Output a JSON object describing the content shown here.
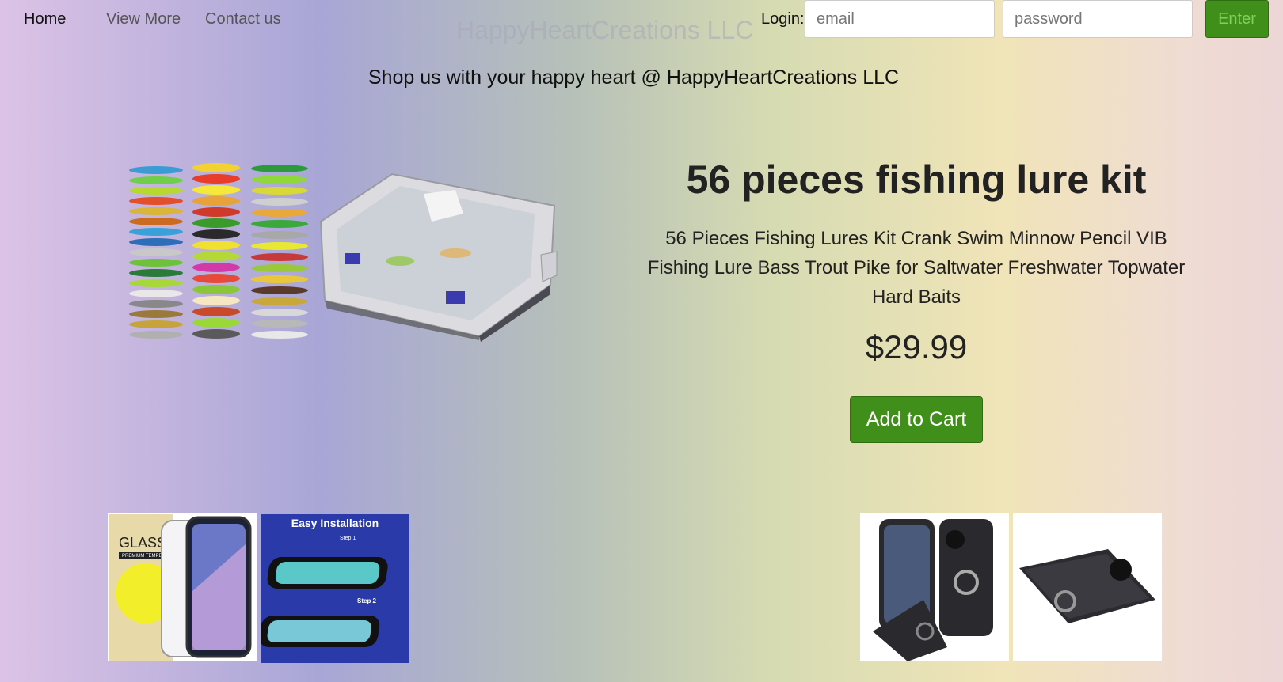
{
  "nav": {
    "home": "Home",
    "view_more": "View More",
    "contact": "Contact us"
  },
  "brand": "HappyHeartCreations LLC",
  "login": {
    "label": "Login:",
    "email_placeholder": "email",
    "password_placeholder": "password",
    "enter_label": "Enter"
  },
  "tagline": "Shop us with your happy heart @ HappyHeartCreations LLC",
  "product": {
    "title": "56 pieces fishing lure kit",
    "description": "56 Pieces Fishing Lures Kit Crank Swim Minnow Pencil VIB Fishing Lure Bass Trout Pike for Saltwater Freshwater Topwater Hard Baits",
    "price": "$29.99",
    "cart_label": "Add to Cart"
  },
  "thumbnails": {
    "glass_label_1": "GLASS",
    "glass_label_2": "PREMIUM TEMPERED",
    "install_title": "Easy Installation",
    "install_step1": "Step 1",
    "install_step2": "Step 2"
  },
  "colors": {
    "accent_green": "#3f8f1a"
  }
}
